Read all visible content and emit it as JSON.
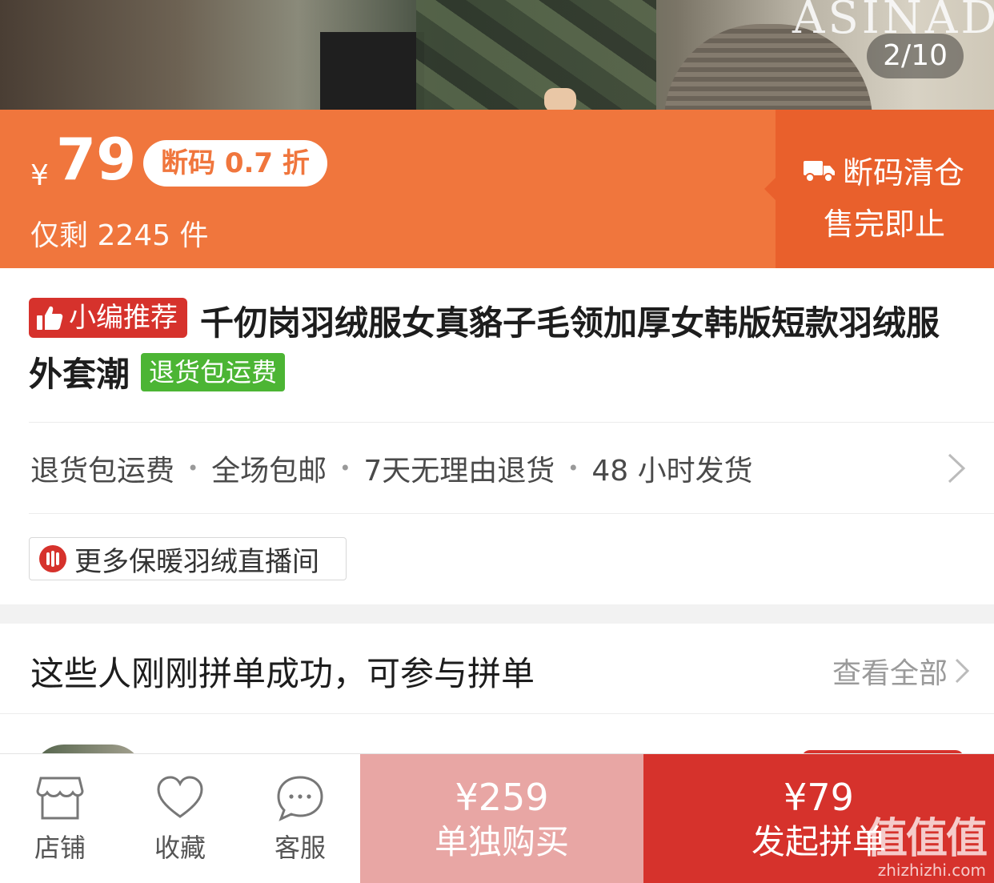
{
  "gallery": {
    "counter": "2/10",
    "sign_text": "ASINADA"
  },
  "price_banner": {
    "currency": "¥",
    "price": "79",
    "discount_badge": "断码 0.7 折",
    "stock_text": "仅剩 2245 件",
    "clearance_title": "断码清仓",
    "clearance_sub": "售完即止"
  },
  "product": {
    "recommend_tag": "小编推荐",
    "title": "千仞岗羽绒服女真貉子毛领加厚女韩版短款羽绒服外套潮",
    "return_tag": "退货包运费"
  },
  "services": [
    "退货包运费",
    "全场包邮",
    "7天无理由退货",
    "48 小时发货"
  ],
  "live_button": "更多保暖羽绒直播间",
  "group_section": {
    "title": "这些人刚刚拼单成功，可参与拼单",
    "view_all": "查看全部"
  },
  "bottom_bar": {
    "tabs": [
      {
        "label": "店铺",
        "icon": "store-icon"
      },
      {
        "label": "收藏",
        "icon": "heart-icon"
      },
      {
        "label": "客服",
        "icon": "chat-icon"
      }
    ],
    "solo_price": "¥259",
    "solo_label": "单独购买",
    "group_price": "¥79",
    "group_label": "发起拼单"
  },
  "watermark": {
    "brand": "值值值",
    "site": "zhizhizhi.com"
  },
  "colors": {
    "banner": "#f0763d",
    "banner_dark": "#e9602c",
    "brand_red": "#d6322c",
    "green": "#4cb534",
    "solo_pink": "#e8a6a4"
  }
}
